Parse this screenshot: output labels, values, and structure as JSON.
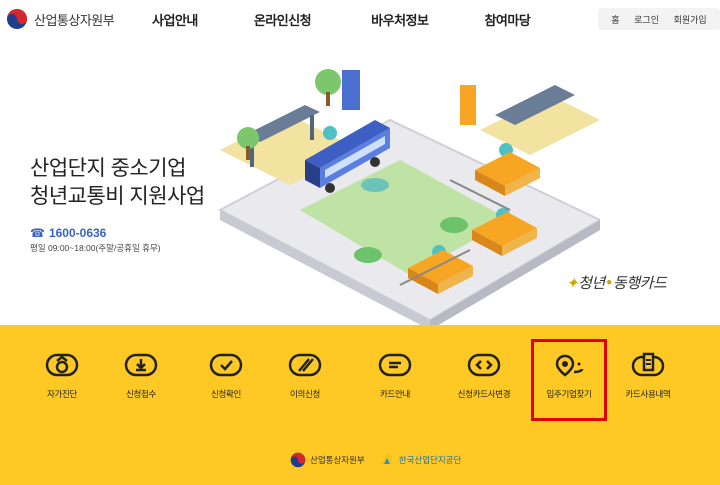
{
  "header": {
    "logo_text": "산업통상자원부",
    "nav": [
      "사업안내",
      "온라인신청",
      "바우처정보",
      "참여마당"
    ],
    "util": [
      "홈",
      "로그인",
      "회원가입"
    ]
  },
  "hero": {
    "title_line1": "산업단지 중소기업",
    "title_line2": "청년교통비 지원사업",
    "phone": "1600-0636",
    "hours": "평일 09:00~18:00(주말/공휴일 휴무)",
    "card_brand_a": "청년",
    "card_brand_b": "동행카드"
  },
  "menu": [
    {
      "label": "자가진단",
      "icon": "self-check-icon"
    },
    {
      "label": "신청접수",
      "icon": "download-icon"
    },
    {
      "label": "신청확인",
      "icon": "check-icon"
    },
    {
      "label": "이의신청",
      "icon": "objection-icon"
    },
    {
      "label": "카드안내",
      "icon": "card-guide-icon"
    },
    {
      "label": "신청카드사변경",
      "icon": "card-change-icon"
    },
    {
      "label": "입주기업찾기",
      "icon": "company-search-icon"
    },
    {
      "label": "카드사용내역",
      "icon": "usage-history-icon"
    }
  ],
  "footer": {
    "ministry": "산업통상자원부",
    "kicox": "한국산업단지공단"
  },
  "colors": {
    "band": "#fec924",
    "highlight": "#e10000",
    "phone": "#3a64c4"
  }
}
